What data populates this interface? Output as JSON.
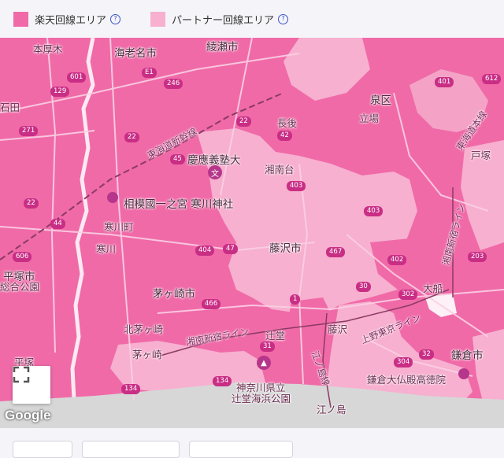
{
  "legend": {
    "rakuten": {
      "label": "楽天回線エリア",
      "color": "#f06aa8"
    },
    "partner": {
      "label": "パートナー回線エリア",
      "color": "#f7b0cf"
    },
    "help_icon": "question-circle-icon"
  },
  "map": {
    "places": [
      {
        "id": "hon",
        "text": "本厚木"
      },
      {
        "id": "ebina",
        "text": "海老名市"
      },
      {
        "id": "ayase",
        "text": "綾瀬市"
      },
      {
        "id": "izumi",
        "text": "泉区"
      },
      {
        "id": "tateba",
        "text": "立場"
      },
      {
        "id": "chogo",
        "text": "長後"
      },
      {
        "id": "higashi",
        "text": "東海道新幹線"
      },
      {
        "id": "keio",
        "text": "慶應義塾大"
      },
      {
        "id": "shonandai",
        "text": "湘南台"
      },
      {
        "id": "totsuka",
        "text": "戸塚"
      },
      {
        "id": "totsukaroad",
        "text": "東海道本線"
      },
      {
        "id": "ishida",
        "text": "石田"
      },
      {
        "id": "ichinomiya",
        "text": "相模國一之宮 寒川神社"
      },
      {
        "id": "samukawa",
        "text": "寒川町"
      },
      {
        "id": "samukawa2",
        "text": "寒川"
      },
      {
        "id": "fujisawa",
        "text": "藤沢市"
      },
      {
        "id": "hiratsuka",
        "text": "平塚市"
      },
      {
        "id": "hiratsukapark",
        "text": "総合公園"
      },
      {
        "id": "chigasaki",
        "text": "茅ヶ崎市"
      },
      {
        "id": "kitachigasaki",
        "text": "北茅ヶ崎"
      },
      {
        "id": "chigasaki2",
        "text": "茅ヶ崎"
      },
      {
        "id": "tsujido",
        "text": "辻堂"
      },
      {
        "id": "fujisawa2",
        "text": "藤沢"
      },
      {
        "id": "ofuna",
        "text": "大船"
      },
      {
        "id": "kamakura",
        "text": "鎌倉市"
      },
      {
        "id": "daibutsu",
        "text": "鎌倉大仏殿高徳院"
      },
      {
        "id": "park",
        "text": "神奈川県立"
      },
      {
        "id": "park2",
        "text": "辻堂海浜公園"
      },
      {
        "id": "enoshima",
        "text": "江ノ島"
      },
      {
        "id": "hiratsuka2",
        "text": "平塚"
      },
      {
        "id": "shonanline",
        "text": "湘南新宿ライン"
      },
      {
        "id": "uenoline",
        "text": "上野東京ライン"
      },
      {
        "id": "enoden",
        "text": "江ノ島線"
      },
      {
        "id": "shonanline2",
        "text": "湘南新宿ライン"
      }
    ],
    "routes": [
      "601",
      "129",
      "E1",
      "246",
      "22",
      "271",
      "45",
      "42",
      "22",
      "401",
      "403",
      "44",
      "606",
      "404",
      "47",
      "467",
      "1",
      "466",
      "402",
      "30",
      "302",
      "32",
      "304",
      "203",
      "134",
      "134",
      "31",
      "403",
      "612",
      "22"
    ],
    "attribution": "Google"
  },
  "controls": {
    "fullscreen_icon": "fullscreen-icon"
  }
}
